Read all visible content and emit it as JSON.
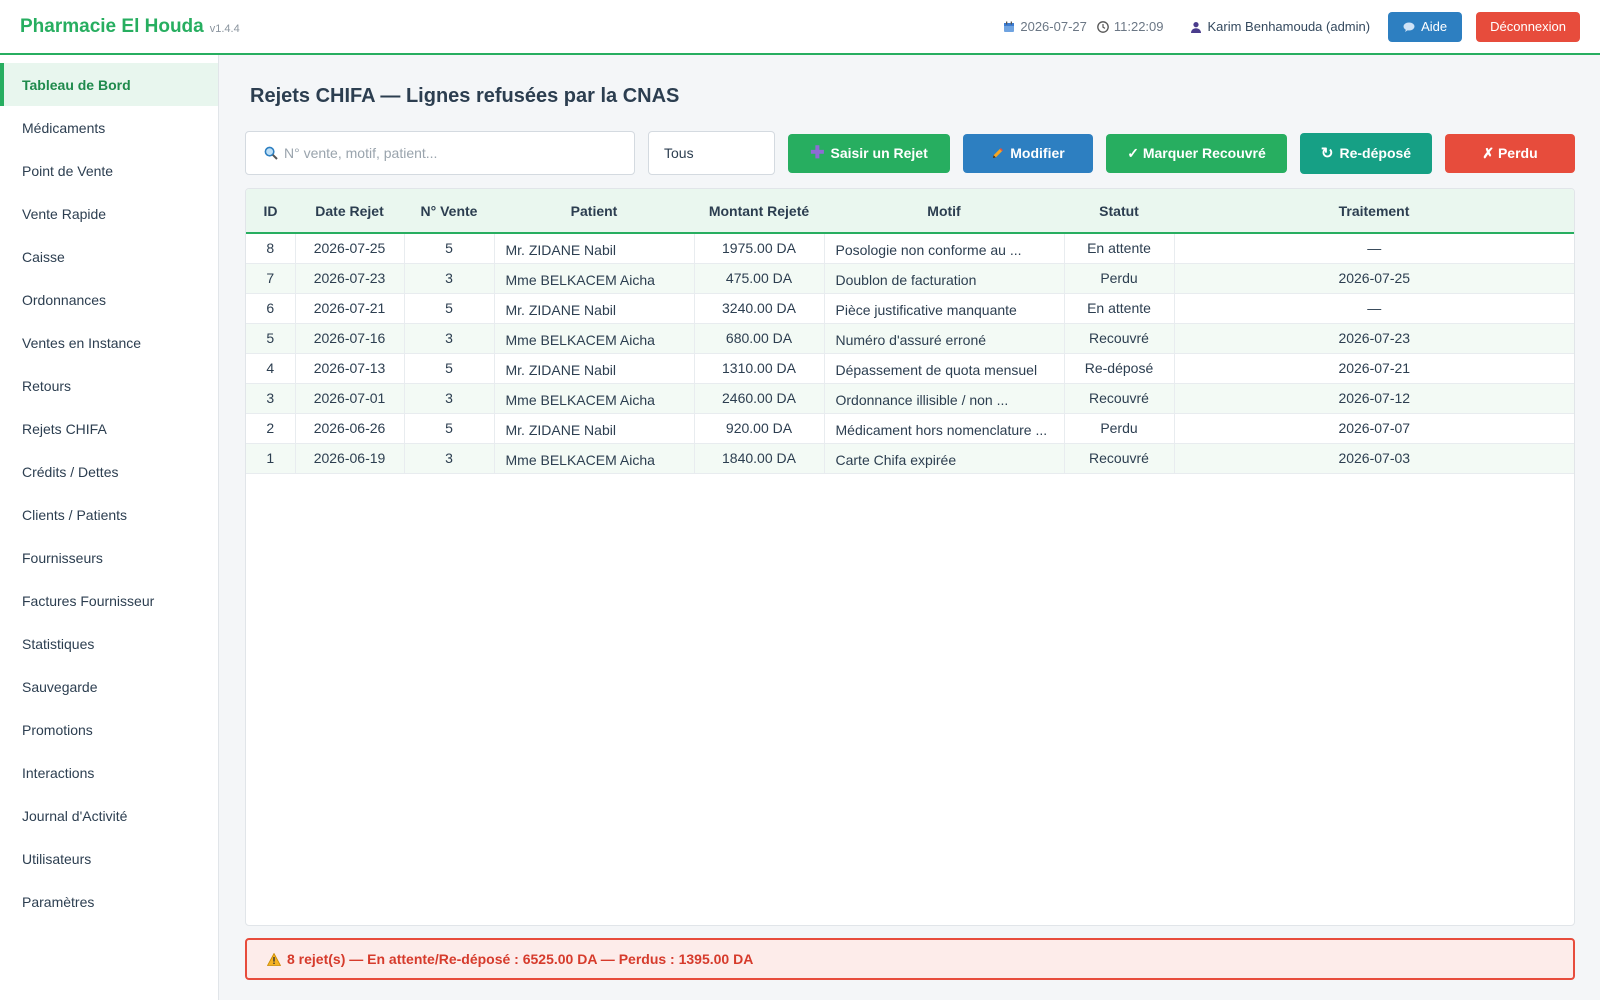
{
  "app": {
    "name": "Pharmacie El Houda",
    "version": "v1.4.4",
    "date": "2026-07-27",
    "time": "11:22:09",
    "user": "Karim Benhamouda (admin)",
    "help_label": "Aide",
    "logout_label": "Déconnexion"
  },
  "sidebar": {
    "items": [
      {
        "label": "Tableau de Bord"
      },
      {
        "label": "Médicaments"
      },
      {
        "label": "Point de Vente"
      },
      {
        "label": "Vente Rapide"
      },
      {
        "label": "Caisse"
      },
      {
        "label": "Ordonnances"
      },
      {
        "label": "Ventes en Instance"
      },
      {
        "label": "Retours"
      },
      {
        "label": "Rejets CHIFA"
      },
      {
        "label": "Crédits / Dettes"
      },
      {
        "label": "Clients / Patients"
      },
      {
        "label": "Fournisseurs"
      },
      {
        "label": "Factures Fournisseur"
      },
      {
        "label": "Statistiques"
      },
      {
        "label": "Sauvegarde"
      },
      {
        "label": "Promotions"
      },
      {
        "label": "Interactions"
      },
      {
        "label": "Journal d'Activité"
      },
      {
        "label": "Utilisateurs"
      },
      {
        "label": "Paramètres"
      }
    ]
  },
  "page": {
    "title": "Rejets CHIFA — Lignes refusées par la CNAS"
  },
  "toolbar": {
    "search_placeholder": "N° vente, motif, patient...",
    "filter_value": "Tous",
    "add_label": "Saisir un Rejet",
    "edit_label": "Modifier",
    "recovered_label": "✓ Marquer Recouvré",
    "redeposited_label": "Re-déposé",
    "lost_label": "✗ Perdu"
  },
  "table": {
    "headers": [
      "ID",
      "Date Rejet",
      "N° Vente",
      "Patient",
      "Montant Rejeté",
      "Motif",
      "Statut",
      "Traitement"
    ],
    "rows": [
      {
        "id": "8",
        "date": "2026-07-25",
        "vente": "5",
        "patient": "Mr. ZIDANE Nabil",
        "montant": "1975.00 DA",
        "motif": "Posologie non conforme au ...",
        "statut": "En attente",
        "traitement": "—"
      },
      {
        "id": "7",
        "date": "2026-07-23",
        "vente": "3",
        "patient": "Mme BELKACEM Aicha",
        "montant": "475.00 DA",
        "motif": "Doublon de facturation",
        "statut": "Perdu",
        "traitement": "2026-07-25"
      },
      {
        "id": "6",
        "date": "2026-07-21",
        "vente": "5",
        "patient": "Mr. ZIDANE Nabil",
        "montant": "3240.00 DA",
        "motif": "Pièce justificative manquante",
        "statut": "En attente",
        "traitement": "—"
      },
      {
        "id": "5",
        "date": "2026-07-16",
        "vente": "3",
        "patient": "Mme BELKACEM Aicha",
        "montant": "680.00 DA",
        "motif": "Numéro d'assuré erroné",
        "statut": "Recouvré",
        "traitement": "2026-07-23"
      },
      {
        "id": "4",
        "date": "2026-07-13",
        "vente": "5",
        "patient": "Mr. ZIDANE Nabil",
        "montant": "1310.00 DA",
        "motif": "Dépassement de quota mensuel",
        "statut": "Re-déposé",
        "traitement": "2026-07-21"
      },
      {
        "id": "3",
        "date": "2026-07-01",
        "vente": "3",
        "patient": "Mme BELKACEM Aicha",
        "montant": "2460.00 DA",
        "motif": "Ordonnance illisible / non ...",
        "statut": "Recouvré",
        "traitement": "2026-07-12"
      },
      {
        "id": "2",
        "date": "2026-06-26",
        "vente": "5",
        "patient": "Mr. ZIDANE Nabil",
        "montant": "920.00 DA",
        "motif": "Médicament hors nomenclature ...",
        "statut": "Perdu",
        "traitement": "2026-07-07"
      },
      {
        "id": "1",
        "date": "2026-06-19",
        "vente": "3",
        "patient": "Mme BELKACEM Aicha",
        "montant": "1840.00 DA",
        "motif": "Carte Chifa expirée",
        "statut": "Recouvré",
        "traitement": "2026-07-03"
      }
    ]
  },
  "summary": {
    "text": "8 rejet(s) — En attente/Re-déposé : 6525.00 DA — Perdus : 1395.00 DA"
  },
  "colors": {
    "brand": "#27ae60",
    "blue": "#2d7fc1",
    "teal": "#16a085",
    "red": "#e74c3c"
  }
}
